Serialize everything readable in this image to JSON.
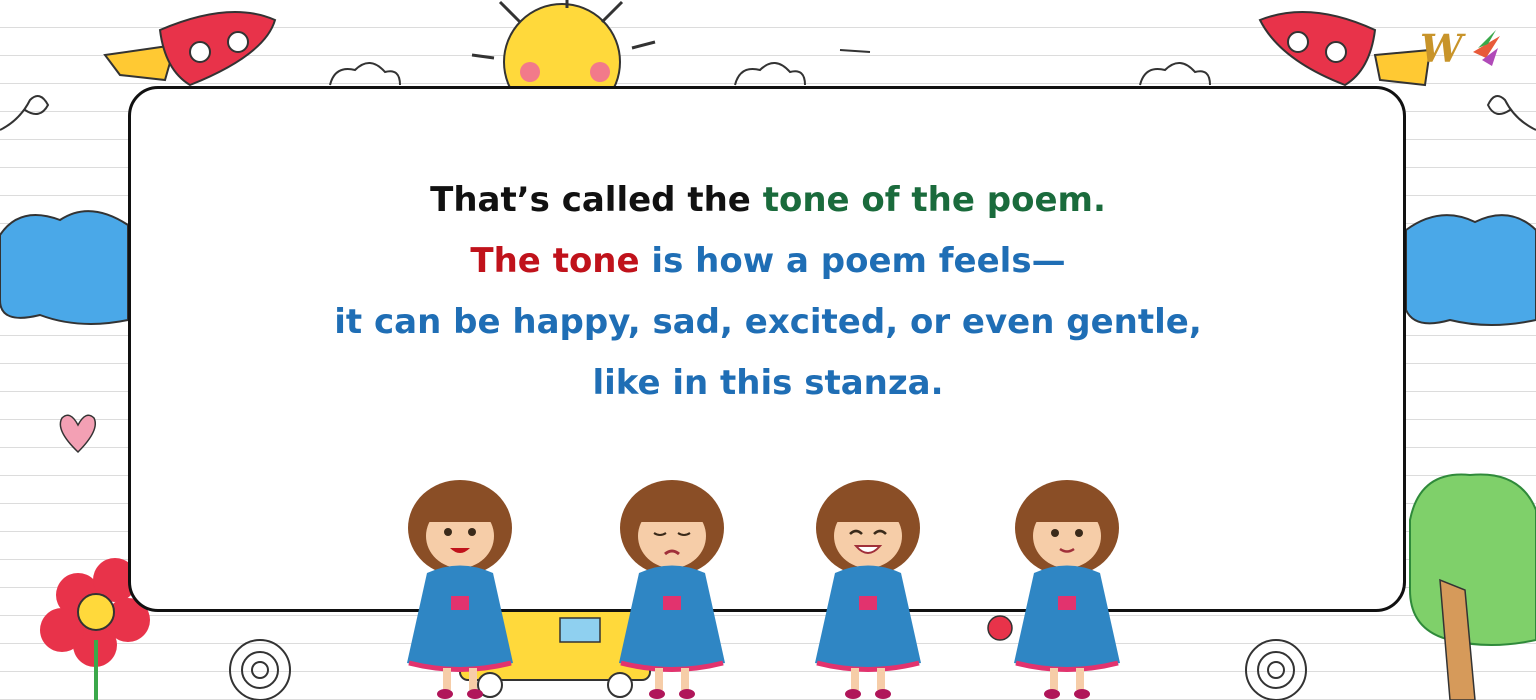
{
  "slide": {
    "line1": {
      "part1": "That’s called the",
      "part2": "tone of the poem."
    },
    "line2": {
      "part1": "The tone",
      "part2": "is how a poem feels—"
    },
    "line3": "it can be happy, sad, excited, or even gentle,",
    "line4": "like in this stanza."
  },
  "logo": {
    "mark": "W"
  },
  "characters": [
    {
      "name": "happy-girl",
      "mood": "happy"
    },
    {
      "name": "sad-girl",
      "mood": "sad"
    },
    {
      "name": "excited-girl",
      "mood": "excited"
    },
    {
      "name": "gentle-girl",
      "mood": "gentle"
    }
  ],
  "colors": {
    "text_black": "#111111",
    "text_green": "#1a6b3c",
    "text_red": "#c0121b",
    "text_blue": "#1f6eb5",
    "dress": "#2f86c4",
    "hair": "#8a4e26",
    "rocket": "#e8334a",
    "sun": "#ffd93b",
    "cloud": "#4aa8e8"
  }
}
